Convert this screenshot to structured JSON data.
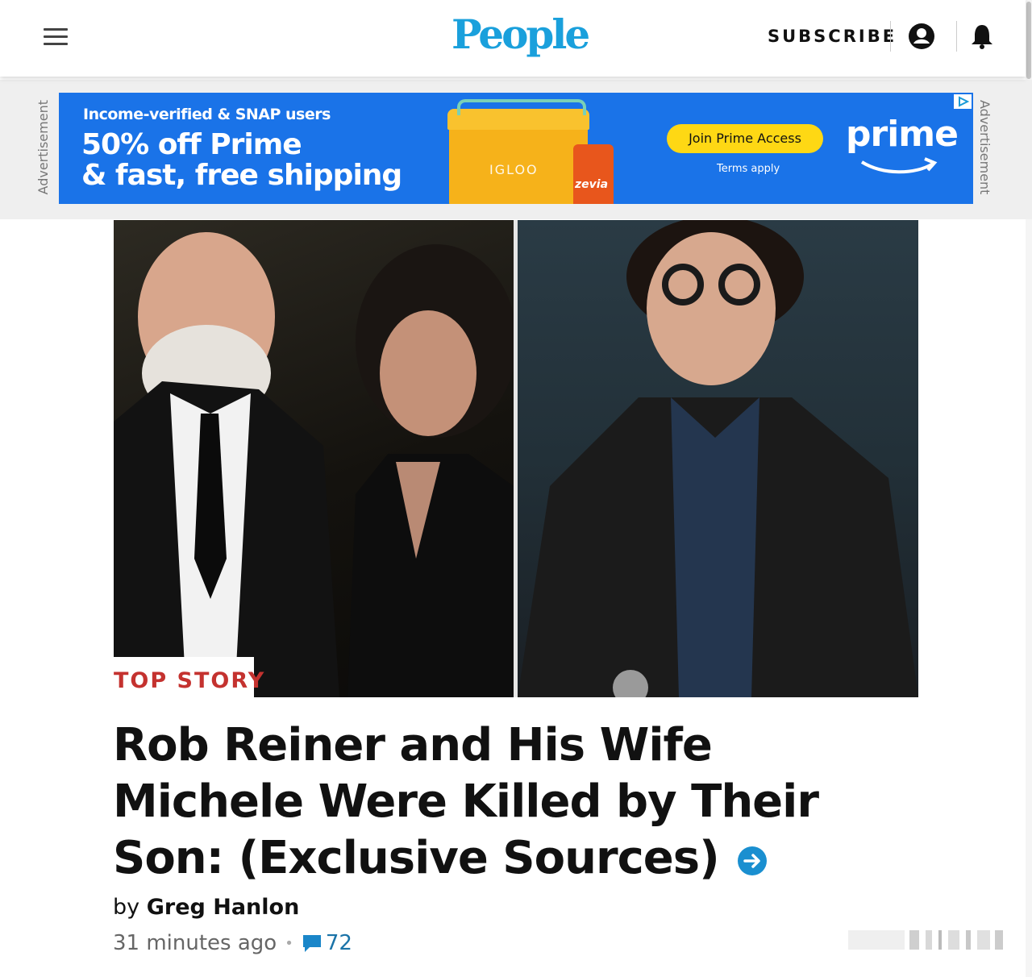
{
  "header": {
    "logo": "People",
    "subscribe_label": "SUBSCRIBE"
  },
  "ad": {
    "side_label": "Advertisement",
    "small_line": "Income-verified & SNAP users",
    "big_line1": "50% off Prime",
    "big_line2": "& fast, free shipping",
    "product_brand": "IGLOO",
    "can_brand": "zevia",
    "cta": "Join Prime Access",
    "terms": "Terms apply",
    "prime_logo": "prime"
  },
  "article": {
    "kicker": "TOP STORY",
    "headline": "Rob Reiner and His Wife Michele Were Killed by Their Son: (Exclusive Sources)",
    "by_prefix": "by",
    "author": "Greg Hanlon",
    "time_ago": "31 minutes ago",
    "comment_count": "72"
  },
  "colors": {
    "brand": "#1aa0dc",
    "kicker": "#c4322f",
    "ad_bg": "#1a73e8",
    "cta_bg": "#fed814"
  },
  "icons": [
    "hamburger-menu-icon",
    "account-icon",
    "bell-icon",
    "arrow-circle-icon",
    "comment-icon"
  ]
}
